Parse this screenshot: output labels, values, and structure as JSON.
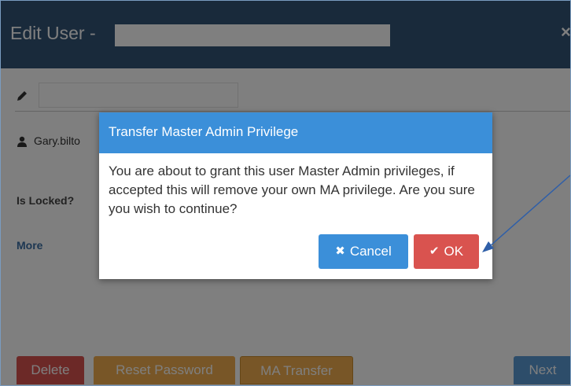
{
  "edit_user": {
    "title": "Edit User -",
    "close_glyph": "×",
    "user_text": "Gary.bilto",
    "locked_label": "Is Locked?",
    "more_link": "More"
  },
  "bottom_buttons": {
    "delete": "Delete",
    "reset_password": "Reset Password",
    "ma_transfer": "MA Transfer",
    "next": "Next"
  },
  "confirm_dialog": {
    "title": "Transfer Master Admin Privilege",
    "message": "You are about to grant this user Master Admin privileges, if accepted this will remove your own MA privilege. Are you sure you wish to continue?",
    "cancel_label": "Cancel",
    "cancel_icon": "✖",
    "ok_label": "OK",
    "ok_icon": "✔"
  },
  "colors": {
    "header": "#335577",
    "dialog_header": "#3b8fd9",
    "danger": "#d9534f",
    "warning": "#f0ad4e",
    "primary": "#3b8fd9"
  }
}
